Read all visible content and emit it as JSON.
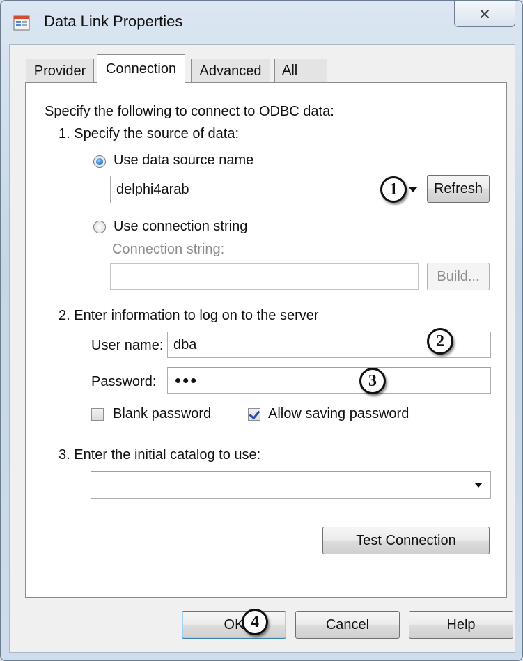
{
  "window": {
    "title": "Data Link Properties"
  },
  "tabs": [
    {
      "label": "Provider"
    },
    {
      "label": "Connection"
    },
    {
      "label": "Advanced"
    },
    {
      "label": "All"
    }
  ],
  "connection": {
    "intro": "Specify the following to connect to ODBC data:",
    "step1": "1. Specify the source of data:",
    "use_dsn_label": "Use data source name",
    "dsn_value": "delphi4arab",
    "refresh_label": "Refresh",
    "use_connstr_label": "Use connection string",
    "connstr_label": "Connection string:",
    "connstr_value": "",
    "build_label": "Build...",
    "step2": "2. Enter information to log on to the server",
    "username_label": "User name:",
    "username_value": "dba",
    "password_label": "Password:",
    "password_value": "•••",
    "blank_password_label": "Blank password",
    "blank_password_checked": false,
    "allow_saving_label": "Allow saving password",
    "allow_saving_checked": true,
    "step3": "3. Enter the initial catalog to use:",
    "catalog_value": "",
    "test_connection_label": "Test Connection"
  },
  "buttons": {
    "ok": "OK",
    "cancel": "Cancel",
    "help": "Help"
  },
  "callouts": [
    "1",
    "2",
    "3",
    "4"
  ],
  "icons": {
    "app": "data-link-properties-icon",
    "close": "close-icon",
    "dropdown": "chevron-down-icon"
  }
}
